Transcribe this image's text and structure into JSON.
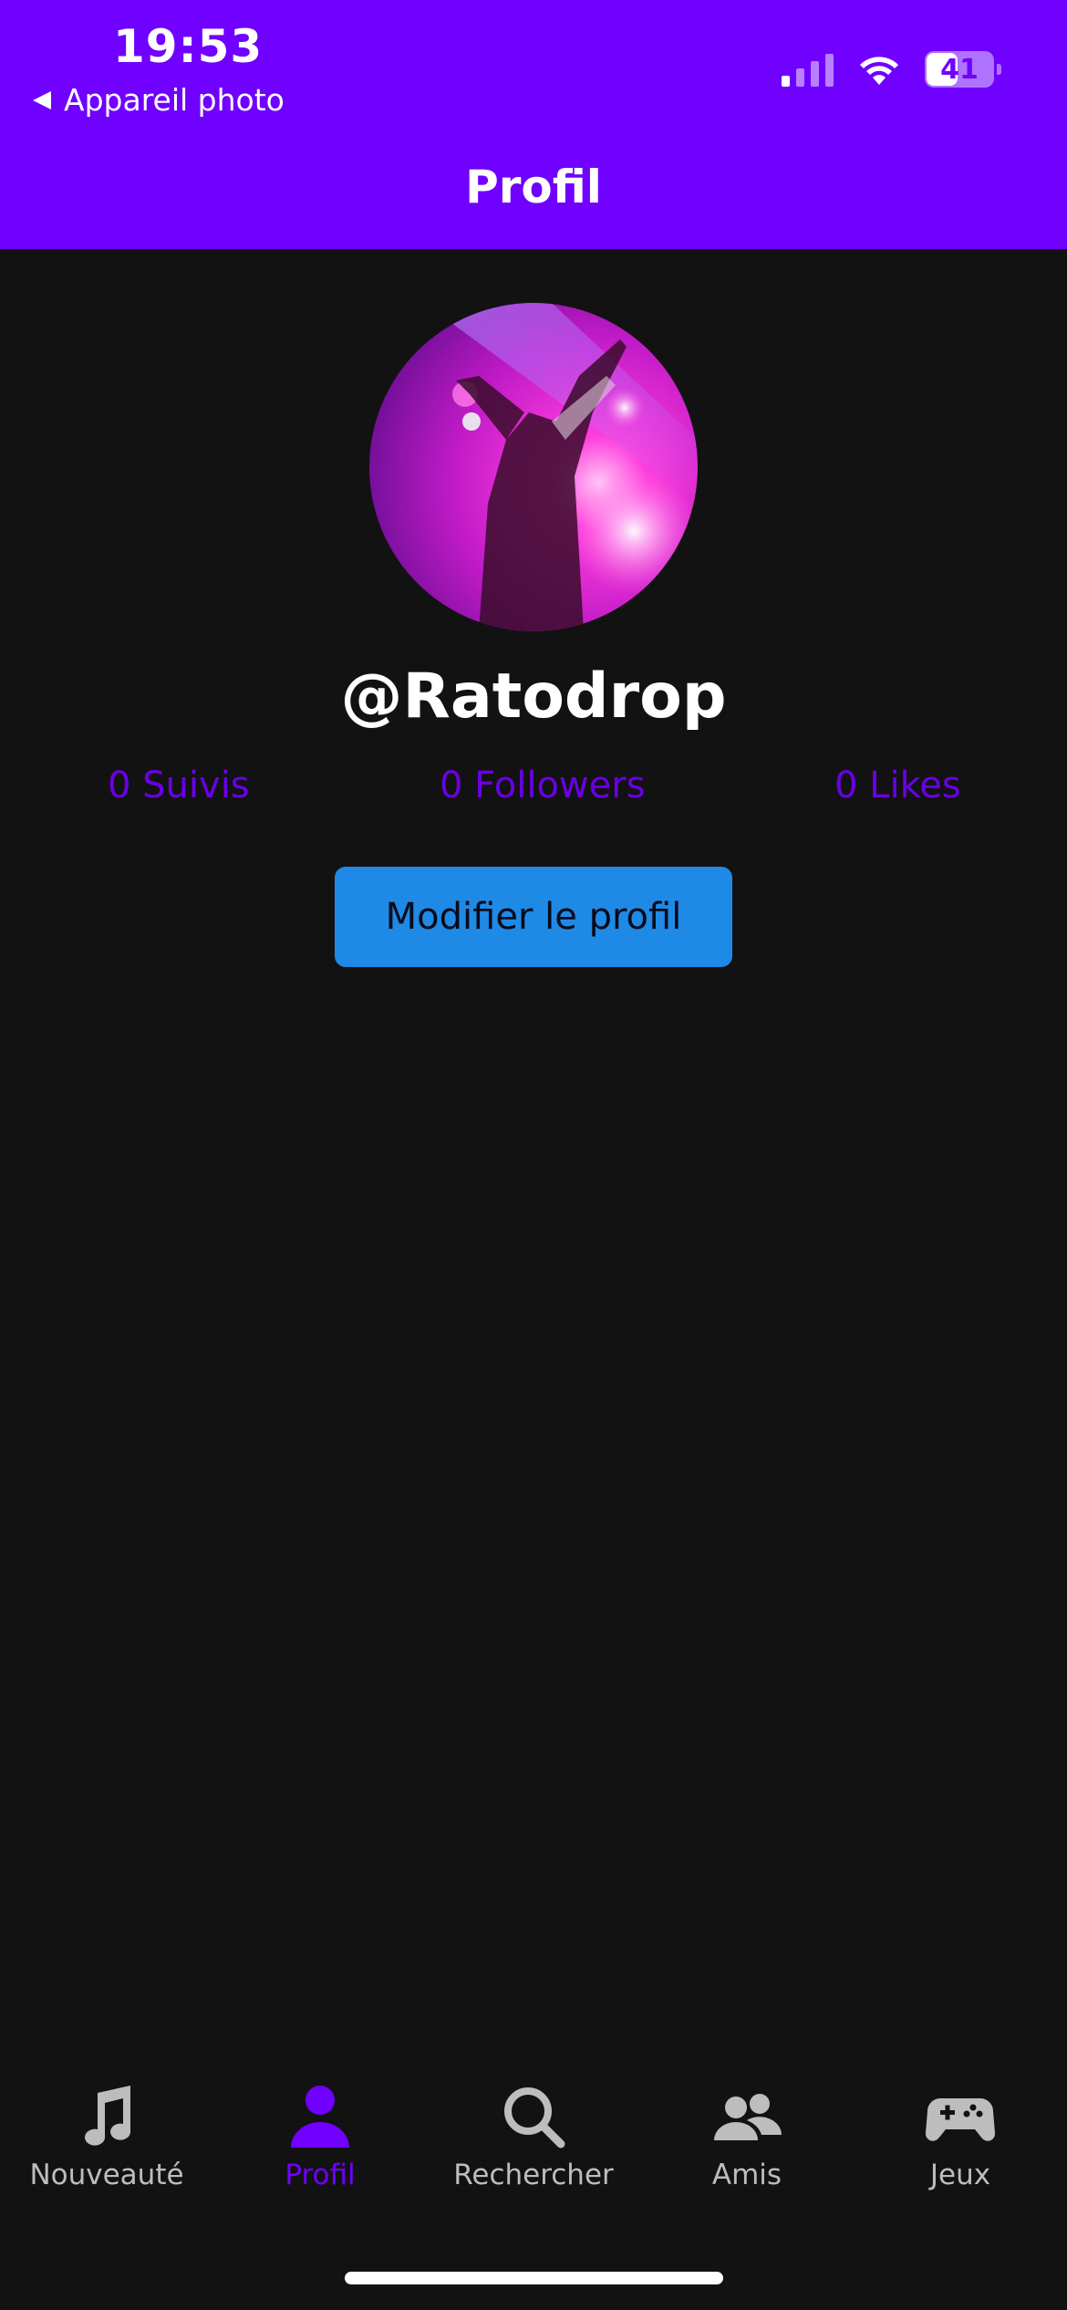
{
  "status_bar": {
    "time": "19:53",
    "back_label": "Appareil photo",
    "battery": "41"
  },
  "header": {
    "title": "Profil"
  },
  "profile": {
    "username": "@Ratodrop",
    "stats": {
      "following": "0 Suivis",
      "followers": "0 Followers",
      "likes": "0 Likes"
    },
    "edit_button": "Modifier le profil"
  },
  "tabbar": {
    "items": [
      {
        "label": "Nouveauté",
        "icon": "music-note-icon",
        "active": false
      },
      {
        "label": "Profil",
        "icon": "person-icon",
        "active": true
      },
      {
        "label": "Rechercher",
        "icon": "search-icon",
        "active": false
      },
      {
        "label": "Amis",
        "icon": "friends-icon",
        "active": false
      },
      {
        "label": "Jeux",
        "icon": "gamepad-icon",
        "active": false
      }
    ]
  },
  "colors": {
    "accent": "#7000ff",
    "background": "#121212",
    "button": "#1e8ae6",
    "inactive_tab": "#bdbdbd"
  }
}
